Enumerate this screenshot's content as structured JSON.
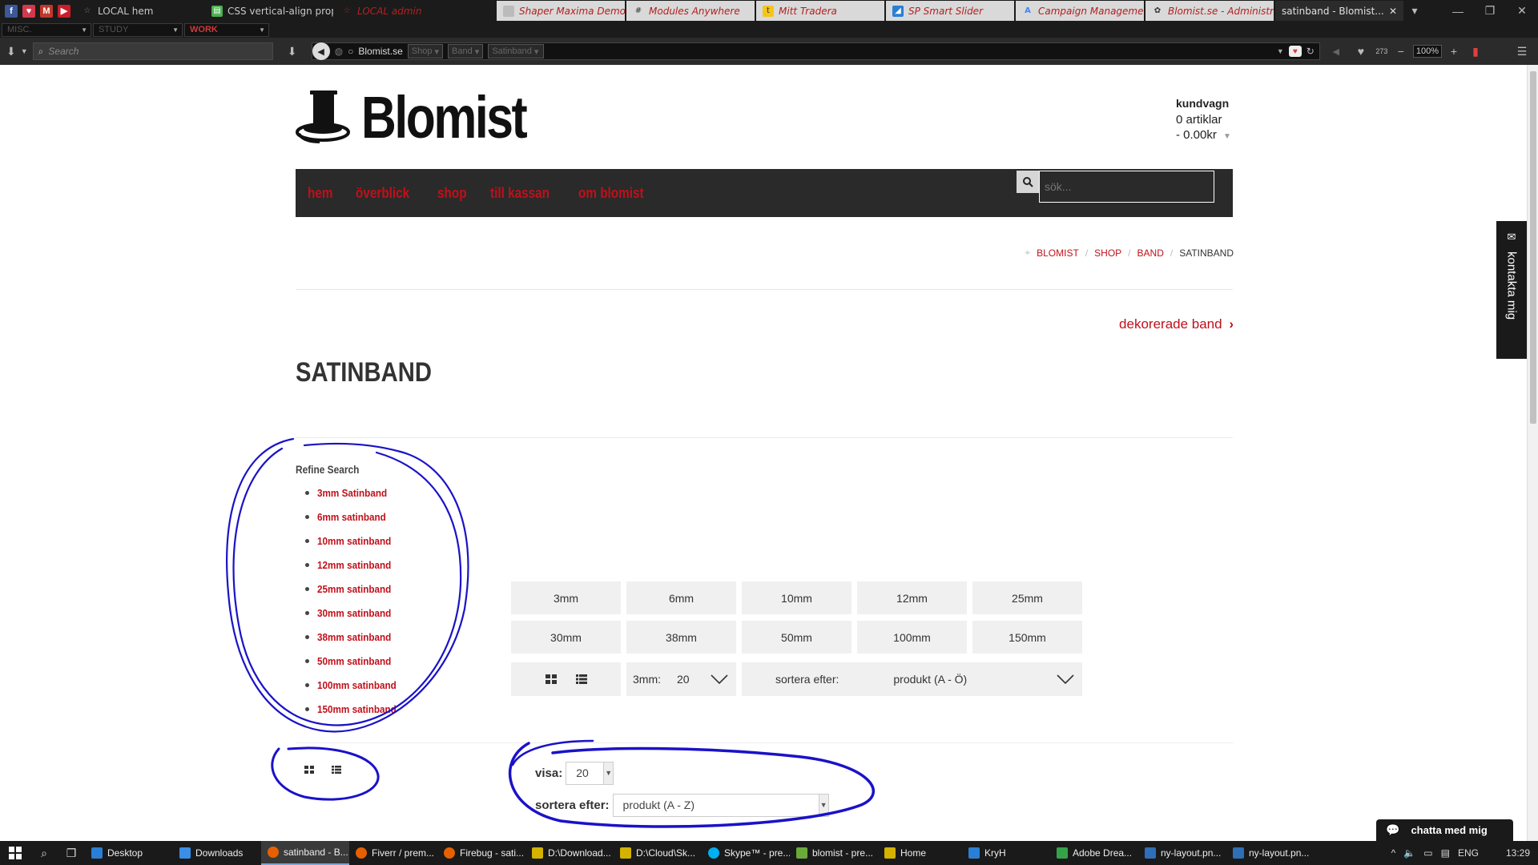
{
  "browser": {
    "pinned_tabs": [
      {
        "icon": "facebook-icon",
        "color": "#3b5998",
        "glyph": "f"
      },
      {
        "icon": "pocket-icon",
        "color": "#d3394c",
        "glyph": "♥"
      },
      {
        "icon": "gmail-icon",
        "color": "#c0392b",
        "glyph": "M"
      },
      {
        "icon": "youtube-icon",
        "color": "#cc1e2a",
        "glyph": "▶"
      }
    ],
    "tabs": [
      {
        "label": "LOCAL hem",
        "style": "dark"
      },
      {
        "label": "CSS vertical-align prop...",
        "style": "dark"
      },
      {
        "label": "LOCAL admin",
        "style": "dark-red"
      },
      {
        "label": "Shaper Maxima Demo ...",
        "style": "light"
      },
      {
        "label": "Modules Anywhere",
        "style": "light"
      },
      {
        "label": "Mitt Tradera",
        "style": "light"
      },
      {
        "label": "SP Smart Slider",
        "style": "light"
      },
      {
        "label": "Campaign Manageme...",
        "style": "light"
      },
      {
        "label": "Blomist.se - Administra...",
        "style": "light"
      },
      {
        "label": "satinband - Blomist...",
        "style": "active"
      }
    ],
    "groups": [
      "MISC.",
      "STUDY",
      "WORK"
    ],
    "search_placeholder": "Search",
    "url_site": "Blomist.se",
    "url_crumbs": [
      "Shop",
      "Band",
      "Satinband"
    ],
    "badge_count": "273",
    "zoom": "100%"
  },
  "site": {
    "logo_text": "Blomist",
    "cart": {
      "title": "kundvagn",
      "items": "0 artiklar",
      "total": "- 0.00kr"
    },
    "menu": [
      "hem",
      "överblick",
      "shop",
      "till kassan",
      "om blomist"
    ],
    "search_placeholder": "sök...",
    "breadcrumbs": [
      "BLOMIST",
      "SHOP",
      "BAND"
    ],
    "breadcrumb_current": "SATINBAND",
    "next_category": "dekorerade band",
    "page_title": "SATINBAND",
    "refine": {
      "title": "Refine Search",
      "items": [
        "3mm Satinband",
        "6mm satinband",
        "10mm satinband",
        "12mm satinband",
        "25mm satinband",
        "30mm satinband",
        "38mm satinband",
        "50mm satinband",
        "100mm satinband",
        "150mm satinband"
      ]
    },
    "sizes": [
      "3mm",
      "6mm",
      "10mm",
      "12mm",
      "25mm",
      "30mm",
      "38mm",
      "50mm",
      "100mm",
      "150mm"
    ],
    "controls": {
      "per_page_label": "3mm:",
      "per_page_value": "20",
      "sort_label": "sortera efter:",
      "sort_value": "produkt (A - Ö)"
    },
    "old_controls": {
      "show_label": "visa:",
      "show_value": "20",
      "sort_label": "sortera efter:",
      "sort_value": "produkt (A - Z)"
    },
    "contact_tab": "kontakta mig",
    "chat_tab": "chatta med mig"
  },
  "taskbar": {
    "tasks": [
      {
        "label": "Desktop",
        "color": "#2a7fd4"
      },
      {
        "label": "Downloads",
        "color": "#3a8ee6"
      },
      {
        "label": "satinband - B...",
        "color": "#e66000",
        "active": true
      },
      {
        "label": "Fiverr / prem...",
        "color": "#e66000"
      },
      {
        "label": "Firebug - sati...",
        "color": "#e66000"
      },
      {
        "label": "D:\\Download...",
        "color": "#d4b200"
      },
      {
        "label": "D:\\Cloud\\Sk...",
        "color": "#d4b200"
      },
      {
        "label": "Skype™ - pre...",
        "color": "#00aff0"
      },
      {
        "label": "blomist - pre...",
        "color": "#6aaa3a"
      },
      {
        "label": "Home",
        "color": "#d4b200"
      },
      {
        "label": "KryH",
        "color": "#2a7fd4"
      },
      {
        "label": "Adobe Drea...",
        "color": "#35a24a"
      },
      {
        "label": "ny-layout.pn...",
        "color": "#2f6fb5"
      },
      {
        "label": "ny-layout.pn...",
        "color": "#2f6fb5"
      }
    ],
    "lang": "ENG",
    "time": "13:29"
  }
}
